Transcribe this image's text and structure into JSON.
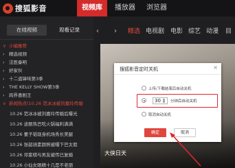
{
  "app": {
    "title": "搜狐影音"
  },
  "top_tabs": [
    {
      "label": "视频库",
      "active": true
    },
    {
      "label": "播放器",
      "active": false
    },
    {
      "label": "浏览器",
      "active": false
    }
  ],
  "sidebar": {
    "buttons": [
      {
        "label": "在线视频",
        "active": true
      },
      {
        "label": "观看记录",
        "active": false
      }
    ],
    "tree": [
      {
        "label": "小编推荐",
        "red": true,
        "arrow": "∨",
        "indent": false
      },
      {
        "label": "精选视频",
        "red": false,
        "arrow": "›",
        "indent": true
      },
      {
        "label": "法医秦明",
        "red": false,
        "arrow": "›",
        "indent": true
      },
      {
        "label": "好家伙",
        "red": false,
        "arrow": "›",
        "indent": true
      },
      {
        "label": "十二道锋味第3季",
        "red": false,
        "arrow": "›",
        "indent": true
      },
      {
        "label": "THE KELLY SHOW第3季",
        "red": false,
        "arrow": "›",
        "indent": true
      },
      {
        "label": "跨界喜剧王",
        "red": false,
        "arrow": "›",
        "indent": true
      },
      {
        "label": "新闻热点(10.26 范冰冰被刘嘉玲传婚",
        "red": true,
        "arrow": "∨",
        "indent": false
      },
      {
        "label": "10.26 范冰冰被刘嘉玲传婚后曝光",
        "red": false,
        "arrow": "",
        "indent": true
      },
      {
        "label": "10.26 迪丽热巴吃火锅福利满满",
        "red": false,
        "arrow": "",
        "indent": true
      },
      {
        "label": "10.26 董子韬现身机场秀长美腿",
        "red": false,
        "arrow": "",
        "indent": true
      },
      {
        "label": "10.26 张韶涵素颜照被曝下巴太假",
        "red": false,
        "arrow": "",
        "indent": true
      },
      {
        "label": "10.26 邓紫棋与男友被传已复婚",
        "red": false,
        "arrow": "",
        "indent": true
      },
      {
        "label": "10.26 小仙女眼精十几是不老朋",
        "red": false,
        "arrow": "",
        "indent": true
      }
    ]
  },
  "category_tabs": [
    {
      "label": "精选",
      "active": true
    },
    {
      "label": "电视剧",
      "active": false
    },
    {
      "label": "电影",
      "active": false
    },
    {
      "label": "综艺",
      "active": false
    },
    {
      "label": "动漫",
      "active": false
    },
    {
      "label": "目",
      "active": false
    }
  ],
  "content": {
    "caption": "大侠日天"
  },
  "dialog": {
    "title": "搜狐影音定时关机",
    "close": "×",
    "options": [
      {
        "label": "上传/下载结束后自动关机",
        "checked": false
      },
      {
        "label": "分钟后自动关机",
        "checked": true
      },
      {
        "label": "取消自动关机",
        "checked": false
      }
    ],
    "minutes_value": "30",
    "ok_label": "确定",
    "cancel_label": "取消"
  },
  "colors": {
    "brand_red": "#d42b2b",
    "annotation_red": "#e0242b"
  }
}
